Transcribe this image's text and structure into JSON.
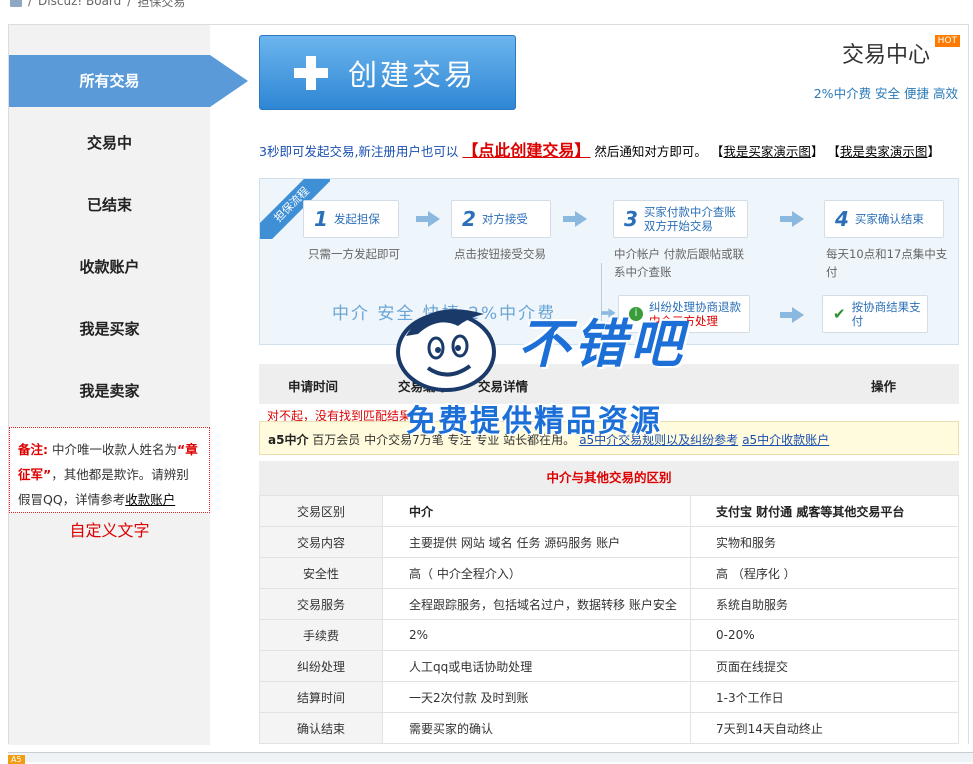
{
  "breadcrumb": {
    "items": [
      "Discuz! Board",
      "担保交易"
    ]
  },
  "sidebar": {
    "items": [
      {
        "label": "所有交易",
        "active": true
      },
      {
        "label": "交易中"
      },
      {
        "label": "已结束"
      },
      {
        "label": "收款账户"
      },
      {
        "label": "我是买家"
      },
      {
        "label": "我是卖家"
      }
    ],
    "note": {
      "prefix": "备注:",
      "text1": "中介唯一收款人姓名为",
      "name": "“章征军”",
      "text2": "，其他都是欺诈。请辨别假冒QQ，详情参考",
      "link": "收款账户"
    },
    "custom_text": "自定义文字"
  },
  "header": {
    "create_button": "创建交易",
    "hub_title": "交易中心",
    "hot_badge": "HOT",
    "hub_subtitle": "2%中介费 安全 便捷 高效"
  },
  "notice": {
    "lead": "3秒即可发起交易,新注册用户也可以",
    "big_link": "【点此创建交易】",
    "after": "然后通知对方即可。",
    "buyer_demo": "我是买家演示图",
    "seller_demo": "我是卖家演示图"
  },
  "flow": {
    "ribbon": "担保流程",
    "steps": [
      {
        "num": "1",
        "label": "发起担保",
        "desc": "只需一方发起即可"
      },
      {
        "num": "2",
        "label": "对方接受",
        "desc": "点击按钮接受交易"
      },
      {
        "num": "3",
        "label": "买家付款中介查账 双方开始交易",
        "desc": "中介帐户 付款后跟帖或联系中介查账"
      },
      {
        "num": "4",
        "label": "买家确认结束",
        "desc": "每天10点和17点集中支付"
      }
    ],
    "dispute": {
      "label": "纠纷处理协商退款",
      "sub": "中介三方处理"
    },
    "settle": "按协商结果支付",
    "slogan": "中介  安全  快捷  2%中介费"
  },
  "table": {
    "headers": [
      "申请时间",
      "交易编号",
      "交易详情",
      "操作"
    ],
    "empty_message": "对不起，没有找到匹配结果"
  },
  "promo": {
    "brand": "a5中介",
    "text": "百万会员 中介交易7万笔 专注 专业 站长都在用。",
    "link1": "a5中介交易规则以及纠纷参考",
    "link2": "a5中介收款账户"
  },
  "compare": {
    "title": "中介与其他交易的区别",
    "rows": [
      [
        "交易区别",
        "中介",
        "支付宝 财付通 威客等其他交易平台"
      ],
      [
        "交易内容",
        "主要提供 网站 域名 任务 源码服务 账户",
        "实物和服务"
      ],
      [
        "安全性",
        "高（   中介全程介入）",
        "高 （程序化 ）"
      ],
      [
        "交易服务",
        "全程跟踪服务，包括域名过户，数据转移 账户安全",
        "系统自助服务"
      ],
      [
        "手续费",
        "2%",
        "0-20%"
      ],
      [
        "纠纷处理",
        "人工qq或电话协助处理",
        "页面在线提交"
      ],
      [
        "结算时间",
        "一天2次付款 及时到账",
        "1-3个工作日"
      ],
      [
        "确认结束",
        "需要买家的确认",
        "7天到14天自动终止"
      ]
    ]
  },
  "watermark": {
    "title": "不错吧",
    "subtitle": "免费提供精品资源"
  },
  "footer": {
    "tag": "A5"
  },
  "colors": {
    "accent": "#5a9ad8",
    "red": "#dd0000",
    "link_blue": "#1a4fb0"
  }
}
